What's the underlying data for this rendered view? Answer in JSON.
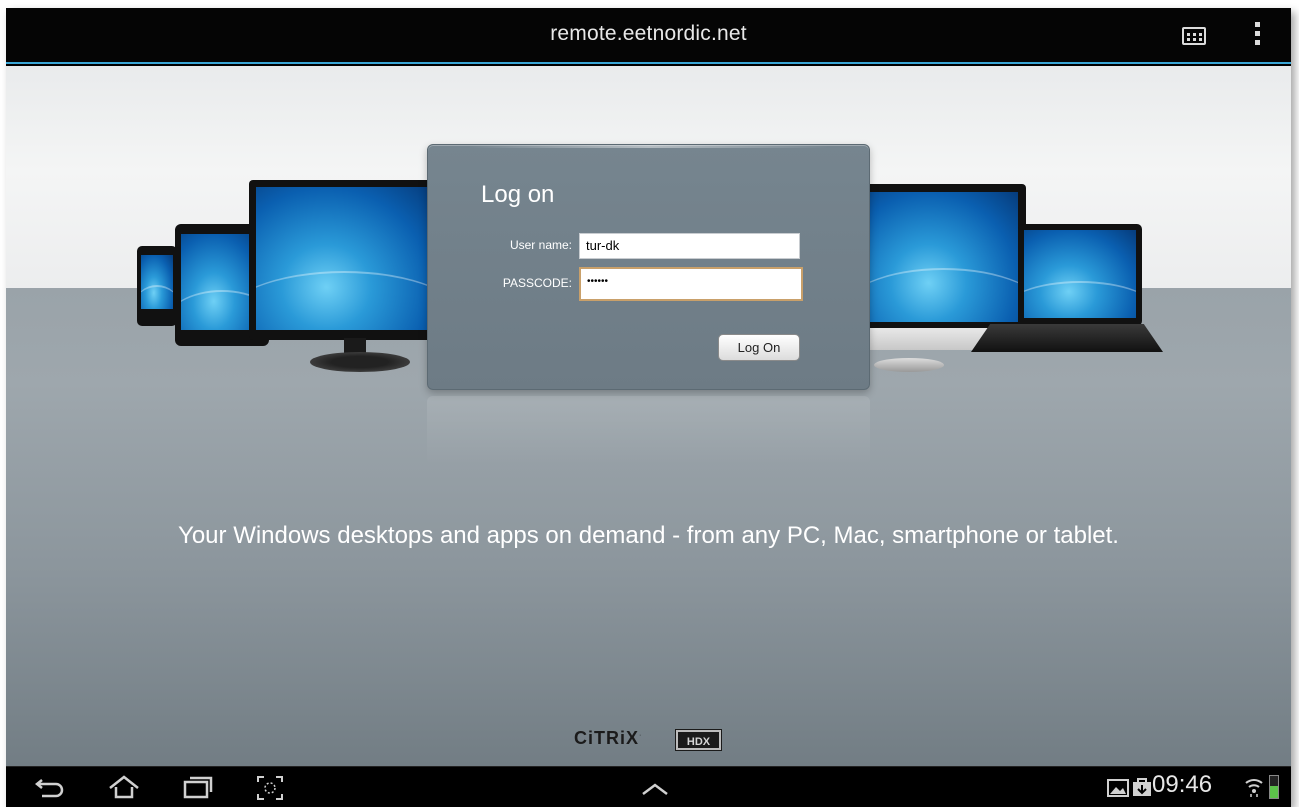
{
  "topbar": {
    "url": "remote.eetnordic.net",
    "icons": [
      "keyboard-icon",
      "overflow-menu-icon"
    ]
  },
  "login": {
    "title": "Log on",
    "username_label": "User name:",
    "username_value": "tur-dk",
    "passcode_label": "PASSCODE:",
    "passcode_value": "••••••",
    "button_label": "Log On"
  },
  "tagline": "Your Windows desktops and apps on demand - from any PC, Mac, smartphone or tablet.",
  "branding": {
    "citrix": "CiTRiX",
    "hdx": "HDX"
  },
  "statusbar": {
    "time": "09:46",
    "icons": [
      "back-icon",
      "home-icon",
      "recent-apps-icon",
      "screenshot-icon",
      "chevron-up-icon",
      "gallery-icon",
      "bag-icon",
      "wifi-icon",
      "battery-icon"
    ]
  },
  "colors": {
    "accent": "#3aa6d6",
    "panel": "#717f89",
    "floor": "#8f9aa1"
  }
}
